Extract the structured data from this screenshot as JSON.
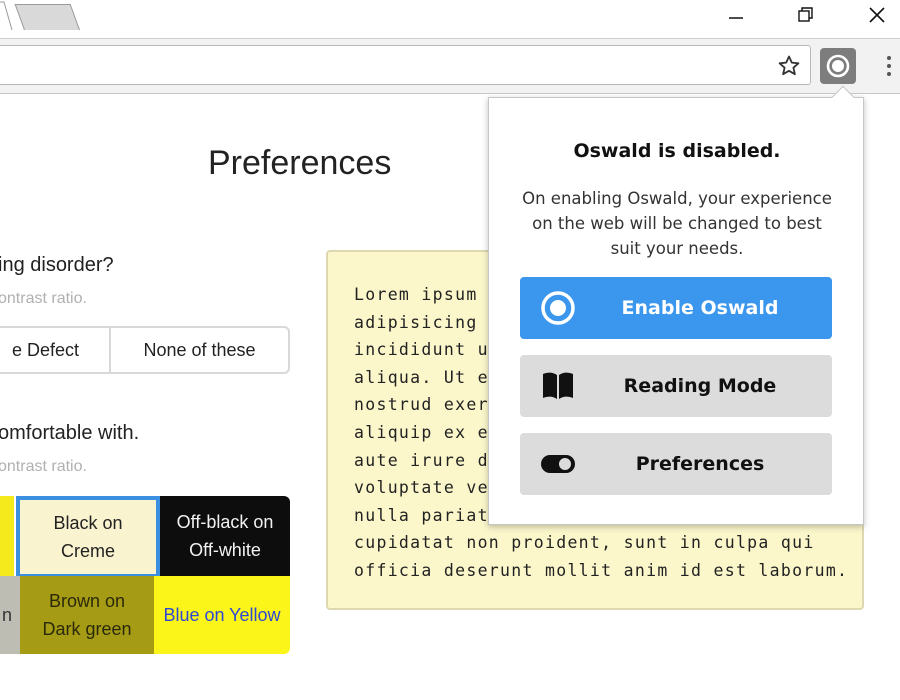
{
  "browser": {
    "window_controls": {
      "minimize_icon": "minimize-icon",
      "restore_icon": "restore-icon",
      "close_icon": "close-icon"
    },
    "toolbar": {
      "bookmark_icon": "star-icon",
      "extension_icon": "oswald-icon",
      "menu_icon": "kebab-menu-icon"
    }
  },
  "page": {
    "title": "Preferences",
    "question1": {
      "text": "ing disorder?",
      "hint": "ontrast ratio.",
      "options": [
        "e Defect",
        "None of these"
      ]
    },
    "question2": {
      "text": "omfortable with.",
      "hint": "ontrast ratio.",
      "swatches": [
        {
          "label": "",
          "selected": false
        },
        {
          "label_line1": "Black on",
          "label_line2": "Creme",
          "selected": true
        },
        {
          "label_line1": "Off-black on",
          "label_line2": "Off-white",
          "selected": false
        },
        {
          "label": "n",
          "selected": false
        },
        {
          "label_line1": "Brown on",
          "label_line2": "Dark green",
          "selected": false
        },
        {
          "label": "Blue on Yellow",
          "selected": false
        }
      ]
    },
    "sample_text": {
      "lines": [
        "Lorem ipsum",
        "adipisicing e",
        "incididunt ut",
        "aliqua. Ut en",
        "nostrud exer",
        "aliquip ex ea",
        "aute irure do",
        "voluptate vel",
        "nulla pariatu",
        "cupidatat non proident, sunt in culpa qui",
        "officia deserunt mollit anim id est laborum."
      ]
    }
  },
  "popup": {
    "title": "Oswald is disabled.",
    "description": "On enabling Oswald, your experience on the web will be changed to best suit your needs.",
    "buttons": {
      "enable": {
        "label": "Enable Oswald",
        "icon": "radio-target-icon"
      },
      "reading": {
        "label": "Reading Mode",
        "icon": "book-icon"
      },
      "preferences": {
        "label": "Preferences",
        "icon": "toggle-icon"
      }
    }
  },
  "colors": {
    "accent_blue": "#3b96ed",
    "sample_bg": "#fbf7cb",
    "button_gray": "#dcdcdc",
    "hint_gray": "#b0b0b0"
  }
}
